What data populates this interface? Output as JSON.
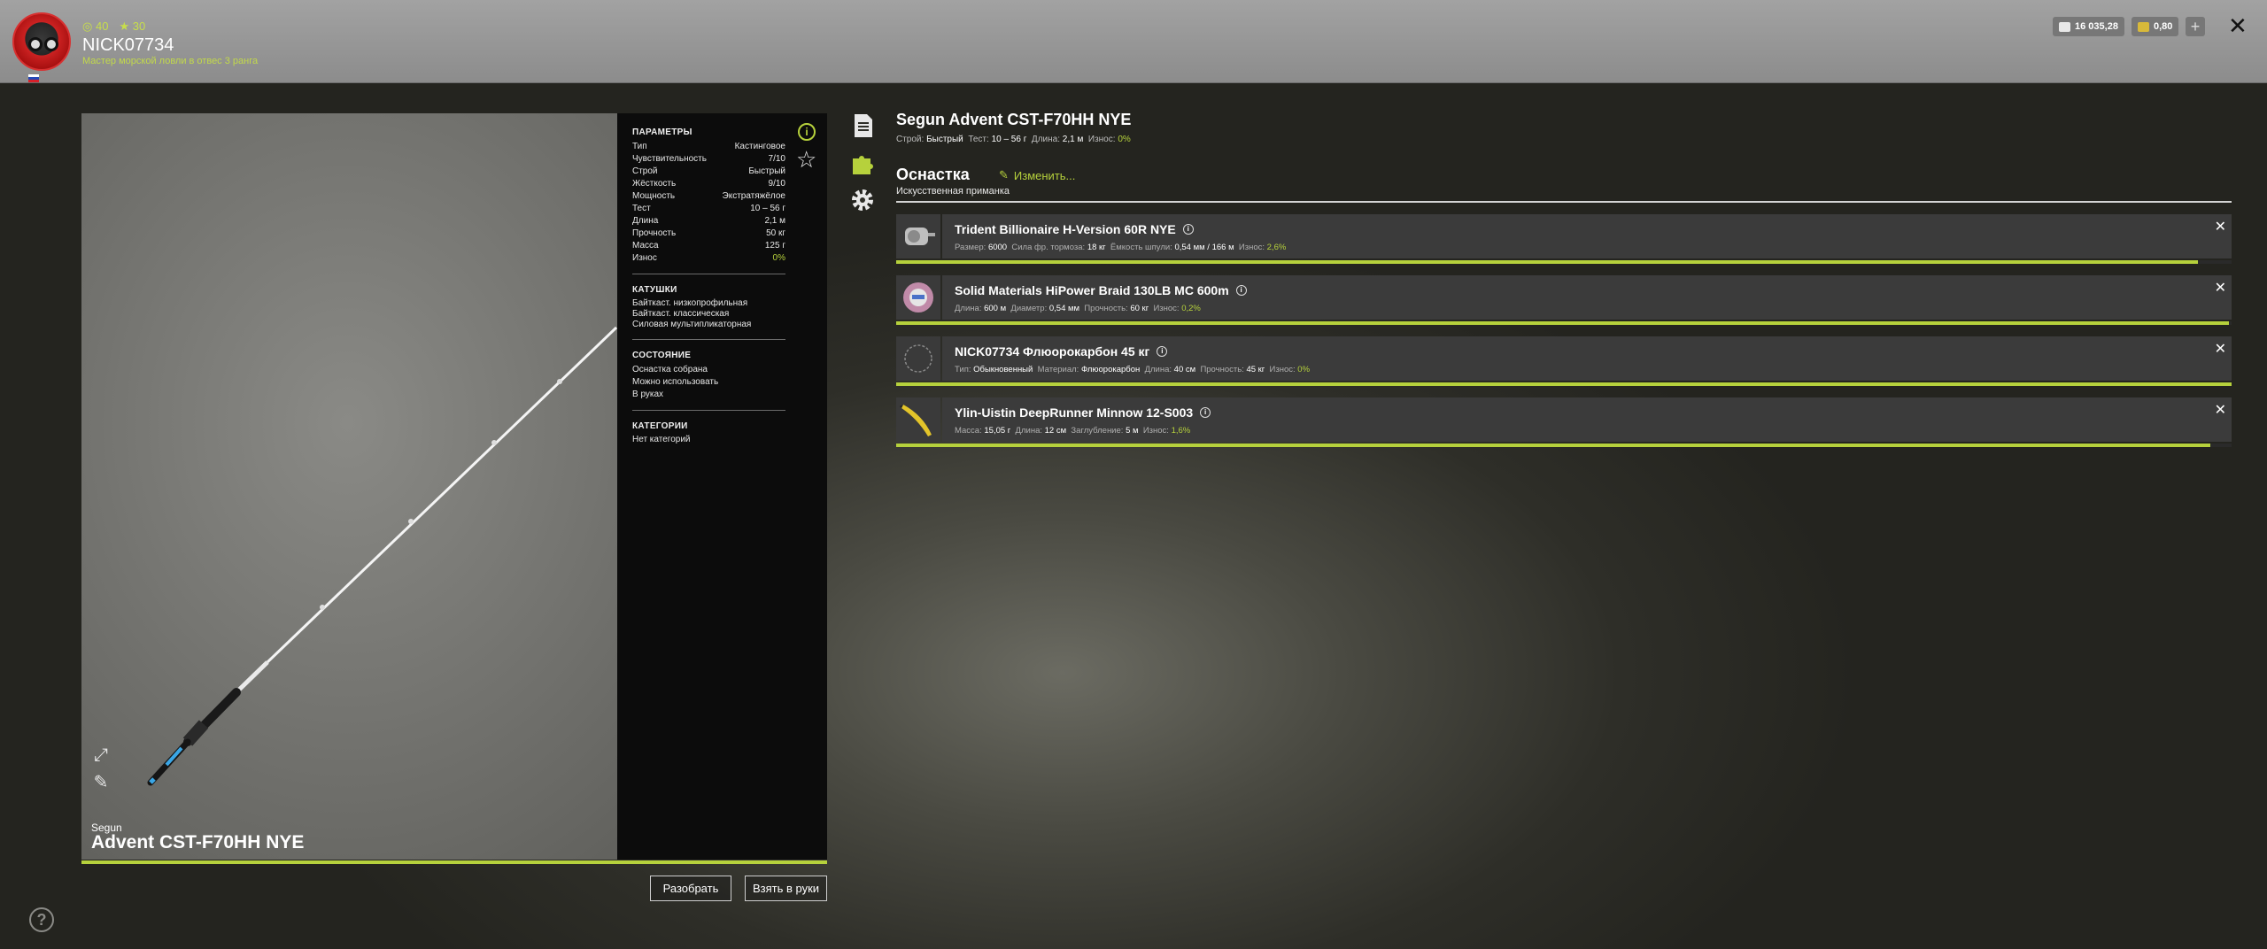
{
  "profile": {
    "level": "40",
    "stars": "30",
    "username": "NICK07734",
    "rank": "Мастер морской ловли в отвес 3 ранга"
  },
  "currency": {
    "silver": "16 035,28",
    "gold": "0,80",
    "add_label": "+",
    "close_label": "✕"
  },
  "rod": {
    "brand": "Segun",
    "model": "Advent CST-F70HH NYE",
    "full_name": "Segun Advent CST-F70HH NYE",
    "specs": [
      {
        "label": "Строй:",
        "value": "Быстрый"
      },
      {
        "label": "Тест:",
        "value": "10 – 56 г"
      },
      {
        "label": "Длина:",
        "value": "2,1 м"
      },
      {
        "label": "Износ:",
        "value": "0%"
      }
    ]
  },
  "params": {
    "title": "ПАРАМЕТРЫ",
    "rows": [
      {
        "label": "Тип",
        "value": "Кастинговое"
      },
      {
        "label": "Чувствительность",
        "value": "7/10"
      },
      {
        "label": "Строй",
        "value": "Быстрый"
      },
      {
        "label": "Жёсткость",
        "value": "9/10"
      },
      {
        "label": "Мощность",
        "value": "Экстратяжёлое"
      },
      {
        "label": "Тест",
        "value": "10 – 56 г"
      },
      {
        "label": "Длина",
        "value": "2,1 м"
      },
      {
        "label": "Прочность",
        "value": "50 кг"
      },
      {
        "label": "Масса",
        "value": "125 г"
      },
      {
        "label": "Износ",
        "value": "0%"
      }
    ],
    "reels_title": "КАТУШКИ",
    "reels": [
      "Байткаст. низкопрофильная",
      "Байткаст. классическая",
      "Силовая мультипликаторная"
    ],
    "state_title": "СОСТОЯНИЕ",
    "states": [
      "Оснастка собрана",
      "Можно использовать",
      "В руках"
    ],
    "categories_title": "КАТЕГОРИИ",
    "categories": "Нет категорий"
  },
  "actions": {
    "disassemble": "Разобрать",
    "take": "Взять в руки",
    "help": "?"
  },
  "tackle": {
    "title": "Оснастка",
    "change_label": "Изменить...",
    "subtitle": "Искусственная приманка",
    "items": [
      {
        "name": "Trident Billionaire H-Version 60R NYE",
        "specs": [
          {
            "label": "Размер:",
            "value": "6000"
          },
          {
            "label": "Сила фр. тормоза:",
            "value": "18 кг"
          },
          {
            "label": "Ёмкость шпули:",
            "value": "0,54 мм / 166 м"
          },
          {
            "label": "Износ:",
            "value": "2,6%"
          }
        ],
        "condition": 0.975
      },
      {
        "name": "Solid Materials HiPower Braid 130LB MC 600m",
        "specs": [
          {
            "label": "Длина:",
            "value": "600 м"
          },
          {
            "label": "Диаметр:",
            "value": "0,54 мм"
          },
          {
            "label": "Прочность:",
            "value": "60 кг"
          },
          {
            "label": "Износ:",
            "value": "0,2%"
          }
        ],
        "condition": 0.998
      },
      {
        "name": "NICK07734 Флюорокарбон 45 кг",
        "specs": [
          {
            "label": "Тип:",
            "value": "Обыкновенный"
          },
          {
            "label": "Материал:",
            "value": "Флюорокарбон"
          },
          {
            "label": "Длина:",
            "value": "40 см"
          },
          {
            "label": "Прочность:",
            "value": "45 кг"
          },
          {
            "label": "Износ:",
            "value": "0%"
          }
        ],
        "condition": 1.0
      },
      {
        "name": "Ylin-Uistin DeepRunner Minnow 12-S003",
        "specs": [
          {
            "label": "Масса:",
            "value": "15,05 г"
          },
          {
            "label": "Длина:",
            "value": "12 см"
          },
          {
            "label": "Заглубление:",
            "value": "5 м"
          },
          {
            "label": "Износ:",
            "value": "1,6%"
          }
        ],
        "condition": 0.984
      }
    ]
  },
  "icons": {
    "info": "i",
    "star": "☆",
    "expand": "⤢",
    "edit": "✎",
    "remove": "✕"
  },
  "colors": {
    "accent": "#b6d13c",
    "panel": "#0c0c0c",
    "topbar": "#9a9a9a"
  }
}
